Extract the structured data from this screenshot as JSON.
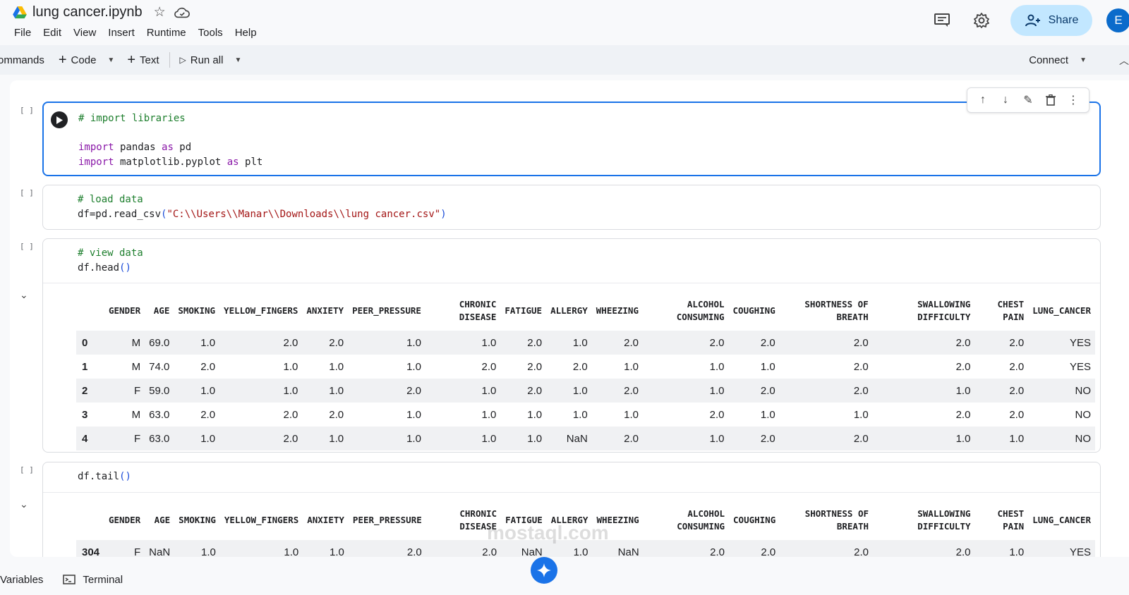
{
  "header": {
    "title": "lung cancer.ipynb",
    "menus": [
      "File",
      "Edit",
      "View",
      "Insert",
      "Runtime",
      "Tools",
      "Help"
    ],
    "share_label": "Share",
    "avatar_letter": "E"
  },
  "toolbar": {
    "commands_label": "ommands",
    "code_label": "Code",
    "text_label": "Text",
    "run_all_label": "Run all",
    "connect_label": "Connect"
  },
  "cells": [
    {
      "bracket": "[ ]",
      "lines": [
        "# import libraries",
        "",
        "import pandas as pd",
        "import matplotlib.pyplot as plt"
      ]
    },
    {
      "bracket": "[ ]",
      "lines": [
        "# load data",
        "df=pd.read_csv(\"C:\\\\Users\\\\Manar\\\\Downloads\\\\lung cancer.csv\")"
      ]
    },
    {
      "bracket": "[ ]",
      "lines": [
        "# view data",
        "df.head()"
      ]
    },
    {
      "bracket": "[ ]",
      "lines": [
        "df.tail()"
      ]
    }
  ],
  "head_table": {
    "columns": [
      "GENDER",
      "AGE",
      "SMOKING",
      "YELLOW_FINGERS",
      "ANXIETY",
      "PEER_PRESSURE",
      "CHRONIC DISEASE",
      "FATIGUE",
      "ALLERGY",
      "WHEEZING",
      "ALCOHOL CONSUMING",
      "COUGHING",
      "SHORTNESS OF BREATH",
      "SWALLOWING DIFFICULTY",
      "CHEST PAIN",
      "LUNG_CANCER"
    ],
    "rows": [
      {
        "index": "0",
        "values": [
          "M",
          "69.0",
          "1.0",
          "2.0",
          "2.0",
          "1.0",
          "1.0",
          "2.0",
          "1.0",
          "2.0",
          "2.0",
          "2.0",
          "2.0",
          "2.0",
          "2.0",
          "YES"
        ]
      },
      {
        "index": "1",
        "values": [
          "M",
          "74.0",
          "2.0",
          "1.0",
          "1.0",
          "1.0",
          "2.0",
          "2.0",
          "2.0",
          "1.0",
          "1.0",
          "1.0",
          "2.0",
          "2.0",
          "2.0",
          "YES"
        ]
      },
      {
        "index": "2",
        "values": [
          "F",
          "59.0",
          "1.0",
          "1.0",
          "1.0",
          "2.0",
          "1.0",
          "2.0",
          "1.0",
          "2.0",
          "1.0",
          "2.0",
          "2.0",
          "1.0",
          "2.0",
          "NO"
        ]
      },
      {
        "index": "3",
        "values": [
          "M",
          "63.0",
          "2.0",
          "2.0",
          "2.0",
          "1.0",
          "1.0",
          "1.0",
          "1.0",
          "1.0",
          "2.0",
          "1.0",
          "1.0",
          "2.0",
          "2.0",
          "NO"
        ]
      },
      {
        "index": "4",
        "values": [
          "F",
          "63.0",
          "1.0",
          "2.0",
          "1.0",
          "1.0",
          "1.0",
          "1.0",
          "NaN",
          "2.0",
          "1.0",
          "2.0",
          "2.0",
          "1.0",
          "1.0",
          "NO"
        ]
      }
    ]
  },
  "tail_table": {
    "columns": [
      "GENDER",
      "AGE",
      "SMOKING",
      "YELLOW_FINGERS",
      "ANXIETY",
      "PEER_PRESSURE",
      "CHRONIC DISEASE",
      "FATIGUE",
      "ALLERGY",
      "WHEEZING",
      "ALCOHOL CONSUMING",
      "COUGHING",
      "SHORTNESS OF BREATH",
      "SWALLOWING DIFFICULTY",
      "CHEST PAIN",
      "LUNG_CANCER"
    ],
    "rows": [
      {
        "index": "304",
        "values": [
          "F",
          "NaN",
          "1.0",
          "1.0",
          "1.0",
          "2.0",
          "2.0",
          "NaN",
          "1.0",
          "NaN",
          "2.0",
          "2.0",
          "2.0",
          "2.0",
          "1.0",
          "YES"
        ]
      }
    ]
  },
  "bottombar": {
    "variables_label": "Variables",
    "terminal_label": "Terminal"
  },
  "watermark": "mostaql.com",
  "colors": {
    "accent": "#1a73e8",
    "share_bg": "#c2e7ff",
    "comment": "#1e7f2e",
    "keyword": "#8a18a8",
    "string": "#a31515"
  }
}
